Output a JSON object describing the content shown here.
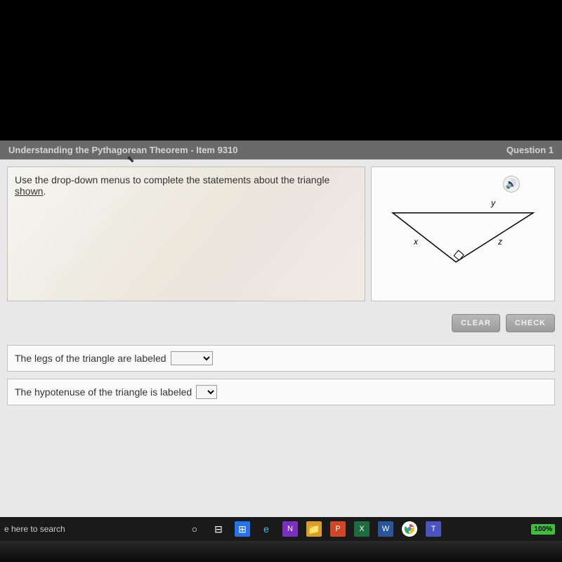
{
  "titlebar": {
    "title": "Understanding the Pythagorean Theorem - Item 9310",
    "question_label": "Question 1"
  },
  "instruction": {
    "text_prefix": "Use the drop-down menus to complete the statements about the triangle ",
    "link_text": "shown",
    "text_suffix": "."
  },
  "buttons": {
    "clear": "CLEAR",
    "check": "CHECK"
  },
  "statements": {
    "s1_text": "The legs of the triangle are labeled",
    "s2_text": "The hypotenuse of the triangle is labeled"
  },
  "triangle": {
    "label_top": "y",
    "label_left": "x",
    "label_right": "z"
  },
  "taskbar": {
    "search": "e here to search",
    "battery": "100%"
  }
}
